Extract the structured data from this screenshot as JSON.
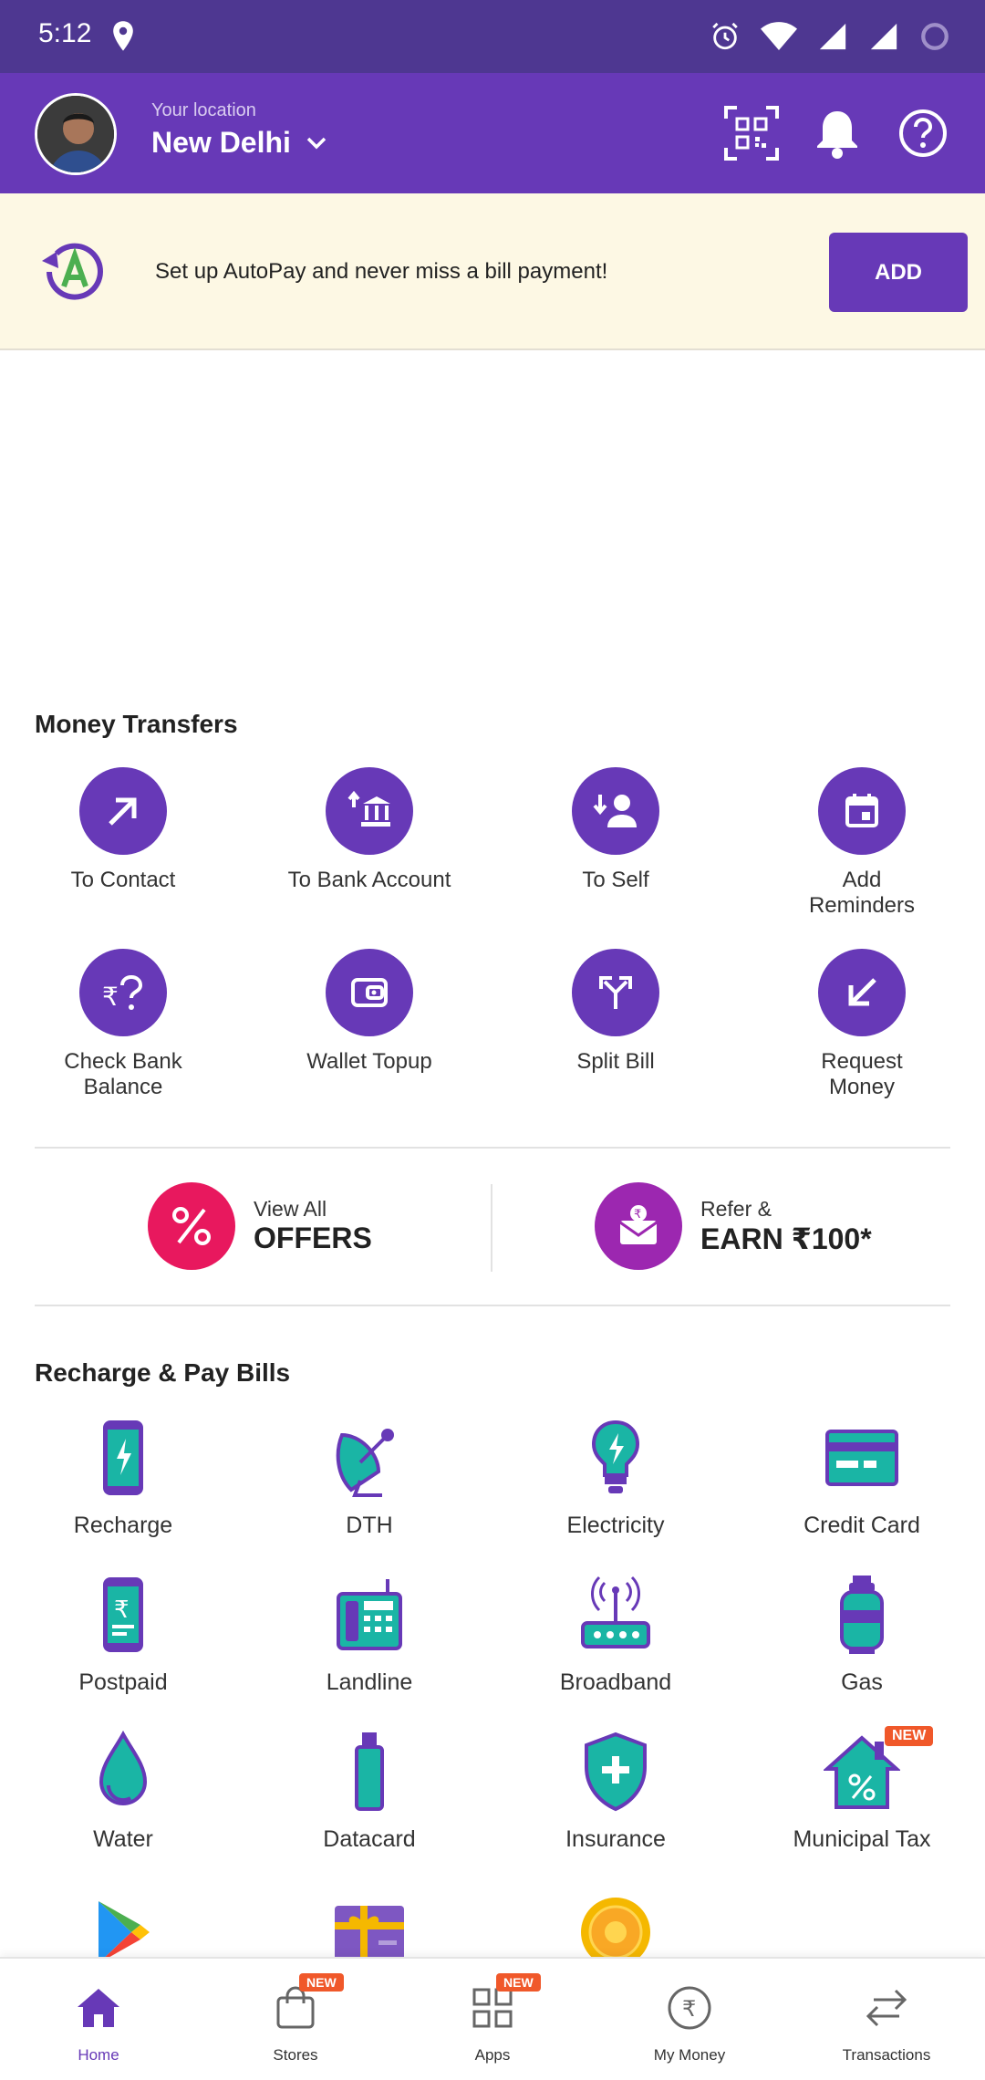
{
  "status_bar": {
    "time": "5:12"
  },
  "header": {
    "location_label": "Your location",
    "location_city": "New Delhi"
  },
  "autopay": {
    "text": "Set up AutoPay and never miss a bill payment!",
    "button_label": "ADD"
  },
  "money_transfers": {
    "title": "Money Transfers",
    "items": [
      {
        "label": "To Contact",
        "icon": "arrow-up-right-icon"
      },
      {
        "label": "To Bank Account",
        "icon": "bank-icon"
      },
      {
        "label": "To Self",
        "icon": "person-arrow-icon"
      },
      {
        "label": "Add Reminders",
        "icon": "calendar-icon"
      },
      {
        "label": "Check Bank Balance",
        "icon": "rupee-question-icon"
      },
      {
        "label": "Wallet Topup",
        "icon": "wallet-icon"
      },
      {
        "label": "Split Bill",
        "icon": "split-icon"
      },
      {
        "label": "Request Money",
        "icon": "arrow-down-left-icon"
      }
    ]
  },
  "offers": {
    "left_small": "View All",
    "left_big": "OFFERS",
    "right_small": "Refer &",
    "right_big": "EARN ₹100*"
  },
  "recharge": {
    "title": "Recharge & Pay Bills",
    "items": [
      {
        "label": "Recharge",
        "icon": "mobile-icon"
      },
      {
        "label": "DTH",
        "icon": "satellite-dish-icon"
      },
      {
        "label": "Electricity",
        "icon": "bulb-icon"
      },
      {
        "label": "Credit Card",
        "icon": "credit-card-icon"
      },
      {
        "label": "Postpaid",
        "icon": "postpaid-mobile-icon"
      },
      {
        "label": "Landline",
        "icon": "landline-icon"
      },
      {
        "label": "Broadband",
        "icon": "router-icon"
      },
      {
        "label": "Gas",
        "icon": "gas-cylinder-icon"
      },
      {
        "label": "Water",
        "icon": "water-drop-icon"
      },
      {
        "label": "Datacard",
        "icon": "usb-icon"
      },
      {
        "label": "Insurance",
        "icon": "shield-plus-icon"
      },
      {
        "label": "Municipal Tax",
        "icon": "house-percent-icon"
      }
    ],
    "municipal_badge": "NEW"
  },
  "bottom_nav": {
    "items": [
      {
        "label": "Home",
        "active": true
      },
      {
        "label": "Stores",
        "badge": "NEW"
      },
      {
        "label": "Apps",
        "badge": "NEW"
      },
      {
        "label": "My Money"
      },
      {
        "label": "Transactions"
      }
    ]
  },
  "colors": {
    "primary": "#6739b7",
    "status_bar": "#4e3791",
    "teal": "#1ab5a5",
    "banner_bg": "#fdf8e4",
    "offers_pink": "#e8185e",
    "refer_purple": "#9c27b0",
    "badge_orange": "#f0582a"
  }
}
